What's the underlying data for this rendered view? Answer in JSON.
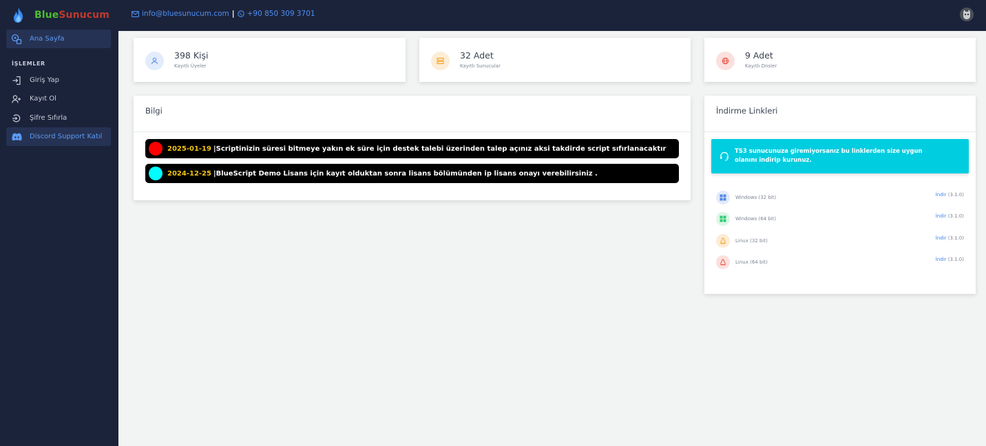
{
  "brand": {
    "part1": "Blue",
    "part2": "Sunucum"
  },
  "header": {
    "email": "info@bluesunucum.com",
    "separator": "|",
    "phone": "+90 850 309 3701"
  },
  "sidebar": {
    "home": "Ana Sayfa",
    "section": "İŞLEMLER",
    "items": [
      "Giriş Yap",
      "Kayıt Ol",
      "Şifre Sıfırla",
      "Discord Support Katıl"
    ]
  },
  "stats": [
    {
      "value": "398 Kişi",
      "label": "Kayıtlı Üyeler",
      "icon": "user-icon",
      "color": "#4f86e8",
      "bg": "#e3ecfb"
    },
    {
      "value": "32 Adet",
      "label": "Kayıtlı Sunucular",
      "icon": "server-icon",
      "color": "#f39c12",
      "bg": "#fdecd6"
    },
    {
      "value": "9 Adet",
      "label": "Kayıtlı Dnsler",
      "icon": "globe-icon",
      "color": "#e74c3c",
      "bg": "#fbe0dd"
    }
  ],
  "info": {
    "title": "Bilgi",
    "notices": [
      {
        "dot": "#ff0000",
        "date": "2025-01-19",
        "text": "|Scriptinizin süresi bitmeye yakın ek süre için destek talebi üzerinden talep açınız aksi takdirde script sıfırlanacaktır"
      },
      {
        "dot": "#00ffff",
        "date": "2024-12-25",
        "text": "|BlueScript Demo Lisans için kayıt olduktan sonra lisans bölümünden ip lisans onayı verebilirsiniz ."
      }
    ]
  },
  "downloads": {
    "title": "İndirme Linkleri",
    "alert": "TS3 sunucunuza giremiyorsanız bu linklerden size uygun olanını indirip kurunuz.",
    "items": [
      {
        "name": "Windows (32 bit)",
        "link": "İndir",
        "version": "(3.1.0)",
        "icon": "windows-icon",
        "color": "#4f86e8",
        "bg": "#e3ecfb"
      },
      {
        "name": "Windows (64 bit)",
        "link": "İndir",
        "version": "(3.1.0)",
        "icon": "windows-icon",
        "color": "#2ecc71",
        "bg": "#dcf6e6"
      },
      {
        "name": "Linux (32 bit)",
        "link": "İndir",
        "version": "(3.1.0)",
        "icon": "linux-icon",
        "color": "#f39c12",
        "bg": "#fdecd6"
      },
      {
        "name": "Linux (64 bit)",
        "link": "İndir",
        "version": "(3.1.0)",
        "icon": "linux-icon",
        "color": "#e74c3c",
        "bg": "#fbe0dd"
      }
    ]
  }
}
